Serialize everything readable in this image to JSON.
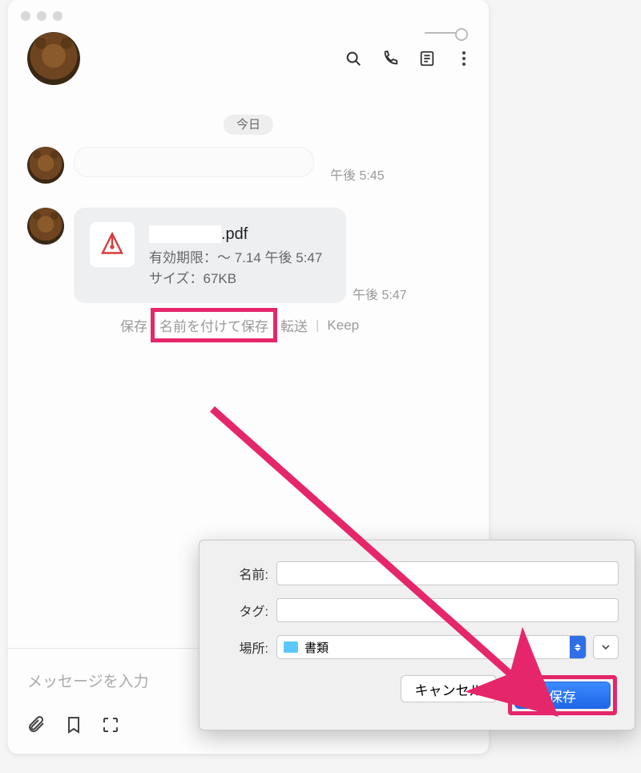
{
  "chat": {
    "date_separator": "今日",
    "messages": [
      {
        "time": "午後 5:45"
      },
      {
        "file": {
          "name_suffix": ".pdf",
          "expiry_label": "有効期限：～ 7.14 午後 5:47",
          "size_label": "サイズ：67KB"
        },
        "time": "午後 5:47",
        "actions": {
          "save": "保存",
          "save_as": "名前を付けて保存",
          "forward": "転送",
          "keep": "Keep"
        }
      }
    ],
    "input_placeholder": "メッセージを入力"
  },
  "save_dialog": {
    "name_label": "名前:",
    "tag_label": "タグ:",
    "location_label": "場所:",
    "location_value": "書類",
    "cancel": "キャンセル",
    "save": "保存"
  }
}
